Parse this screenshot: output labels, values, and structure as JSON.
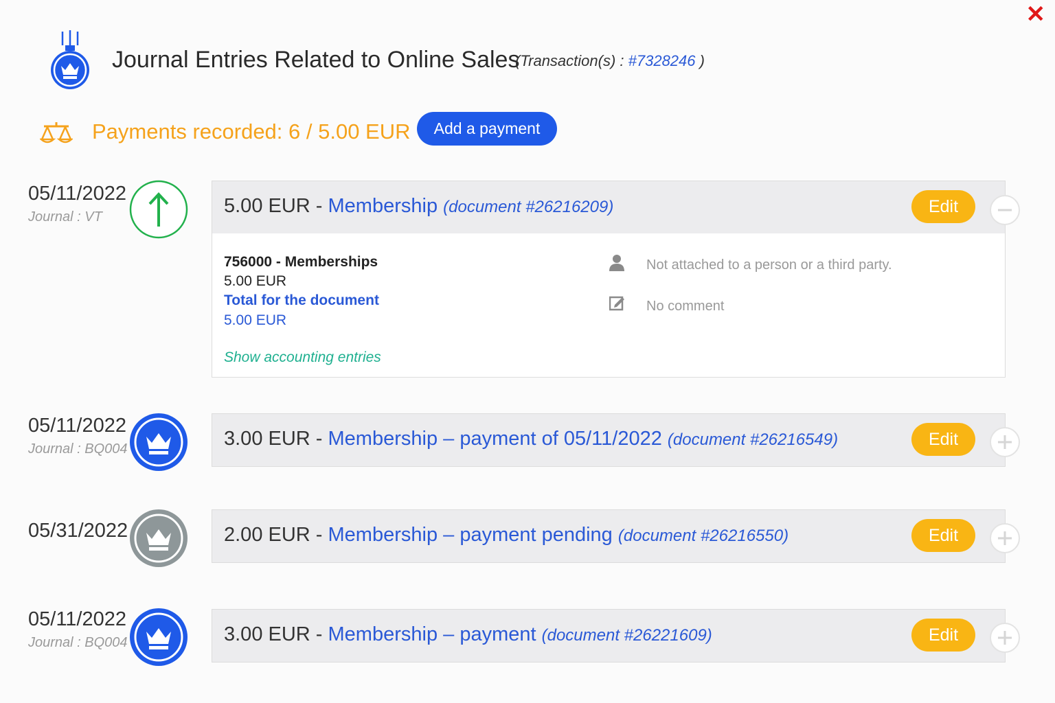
{
  "header": {
    "title": "Journal Entries Related to Online Sales",
    "transaction_prefix": "(Transaction(s) : ",
    "transaction_id": "#7328246",
    "transaction_suffix": " )",
    "close_icon": "close-icon"
  },
  "payments": {
    "summary": "Payments recorded: 6 / 5.00 EUR",
    "add_button": "Add a payment",
    "accent_color": "#f5a21b"
  },
  "entries": [
    {
      "date": "05/11/2022",
      "journal": "Journal : VT",
      "icon": "arrow-up-icon",
      "amount": "5.00 EUR",
      "sep": " - ",
      "label": "Membership",
      "document": "(document #26216209)",
      "edit": "Edit",
      "expanded": true,
      "details": {
        "account": "756000 - Memberships",
        "account_amount": "5.00 EUR",
        "total_label": "Total for the document",
        "total_amount": "5.00 EUR",
        "show_entries": "Show accounting entries",
        "person": "Not attached to a person or a third party.",
        "comment": "No comment"
      }
    },
    {
      "date": "05/11/2022",
      "journal": "Journal : BQ004",
      "icon": "crown-icon",
      "amount": "3.00 EUR",
      "sep": " - ",
      "label": "Membership – payment of 05/11/2022",
      "document": "(document #26216549)",
      "edit": "Edit",
      "expanded": false
    },
    {
      "date": "05/31/2022",
      "journal": "",
      "icon": "crown-icon",
      "amount": "2.00 EUR",
      "sep": " - ",
      "label": "Membership – payment pending",
      "document": "(document #26216550)",
      "edit": "Edit",
      "expanded": false
    },
    {
      "date": "05/11/2022",
      "journal": "Journal : BQ004",
      "icon": "crown-icon",
      "amount": "3.00 EUR",
      "sep": " - ",
      "label": "Membership – payment",
      "document": "(document #26221609)",
      "edit": "Edit",
      "expanded": false
    }
  ],
  "colors": {
    "primary_blue": "#1f5ae8",
    "link_blue": "#2a59d6",
    "edit_yellow": "#f9b514",
    "pending_gray": "#8e9799",
    "success_green": "#22b14c"
  }
}
